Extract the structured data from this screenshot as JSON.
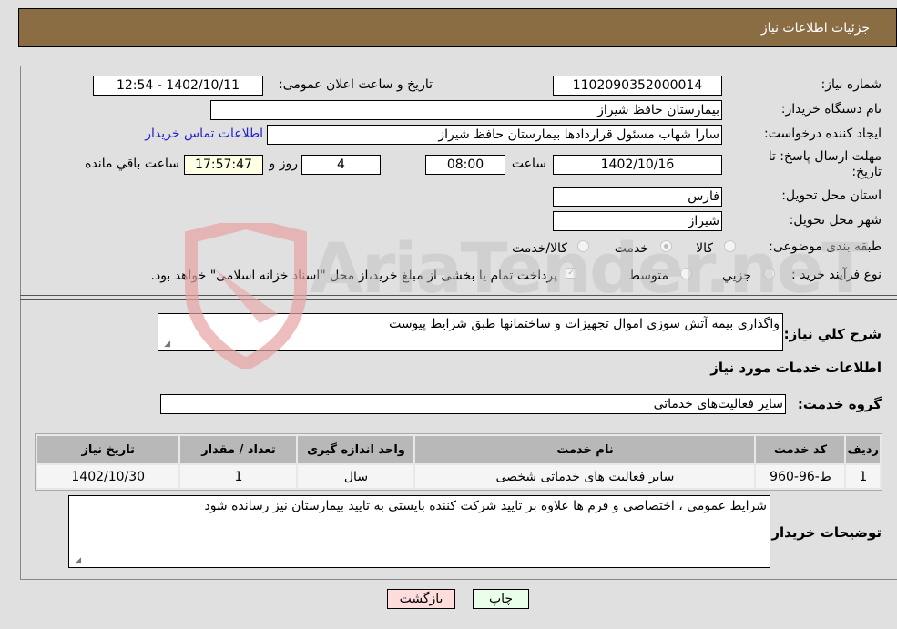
{
  "header": {
    "title": "جزئیات اطلاعات نیاز"
  },
  "fields": {
    "need_number_label": "شماره نیاز:",
    "need_number": "1102090352000014",
    "announce_label": "تاریخ و ساعت اعلان عمومی:",
    "announce_value": "1402/10/11 - 12:54",
    "buyer_org_label": "نام دستگاه خریدار:",
    "buyer_org": "بیمارستان حافظ شیراز",
    "creator_label": "ایجاد کننده درخواست:",
    "creator": "سارا شهاب مسئول قراردادها بیمارستان حافظ شیراز",
    "contact_link": "اطلاعات تماس خریدار",
    "deadline_label_line1": "مهلت ارسال پاسخ: تا",
    "deadline_label_line2": "تاریخ:",
    "deadline_date": "1402/10/16",
    "time_label": "ساعت",
    "deadline_time": "08:00",
    "days_value": "4",
    "days_label": "روز و",
    "remaining_time": "17:57:47",
    "remaining_label": "ساعت باقي مانده",
    "province_label": "استان محل تحویل:",
    "province": "فارس",
    "city_label": "شهر محل تحویل:",
    "city": "شیراز",
    "category_label": "طبقه بندی موضوعی:",
    "category_options": [
      "کالا",
      "خدمت",
      "کالا/خدمت"
    ],
    "category_selected": "خدمت",
    "process_label": "نوع فرآیند خرید :",
    "process_options": [
      "جزيي",
      "متوسط"
    ],
    "payment_note": "پرداخت تمام یا بخشی از مبلغ خرید،از محل \"اسناد خزانه اسلامی\" خواهد بود."
  },
  "description": {
    "label": "شرح کلي نیاز:",
    "value": "واگذاری بیمه آتش سوزی اموال تجهیزات و ساختمانها طبق شرایط پیوست"
  },
  "services": {
    "section_title": "اطلاعات خدمات مورد نیاز",
    "group_label": "گروه خدمت:",
    "group_value": "سایر فعالیت‌های خدماتی",
    "columns": [
      "ردیف",
      "کد خدمت",
      "نام خدمت",
      "واحد اندازه گیری",
      "تعداد / مقدار",
      "تاریخ نیاز"
    ],
    "rows": [
      [
        "1",
        "ط-96-960",
        "سایر فعالیت های خدماتی شخصی",
        "سال",
        "1",
        "1402/10/30"
      ]
    ]
  },
  "buyer_notes": {
    "label": "توضیحات خریدار:",
    "value": "شرایط عمومی ، اختصاصی و فرم ها علاوه بر تایید شرکت کننده بایستی به تایید بیمارستان نیز رسانده شود"
  },
  "buttons": {
    "print": "چاپ",
    "back": "بازگشت"
  },
  "watermark": {
    "text": "AriaTender.neT"
  },
  "colors": {
    "header_bg": "#8b6d43",
    "print_bg": "#eaffea",
    "back_bg": "#ffdddd",
    "link": "#2222cc"
  }
}
